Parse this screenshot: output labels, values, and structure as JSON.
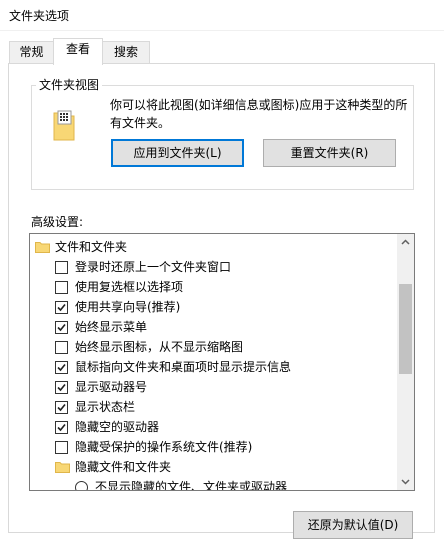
{
  "window": {
    "title": "文件夹选项"
  },
  "tabs": [
    {
      "label": "常规"
    },
    {
      "label": "查看"
    },
    {
      "label": "搜索"
    }
  ],
  "folder_views": {
    "legend": "文件夹视图",
    "description": "你可以将此视图(如详细信息或图标)应用于这种类型的所有文件夹。",
    "apply_button": "应用到文件夹(L)",
    "reset_button": "重置文件夹(R)"
  },
  "advanced": {
    "label": "高级设置:",
    "items": [
      {
        "type": "folder",
        "label": "文件和文件夹",
        "indent": 0
      },
      {
        "type": "checkbox",
        "label": "登录时还原上一个文件夹窗口",
        "checked": false,
        "indent": 1
      },
      {
        "type": "checkbox",
        "label": "使用复选框以选择项",
        "checked": false,
        "indent": 1
      },
      {
        "type": "checkbox",
        "label": "使用共享向导(推荐)",
        "checked": true,
        "indent": 1
      },
      {
        "type": "checkbox",
        "label": "始终显示菜单",
        "checked": true,
        "indent": 1
      },
      {
        "type": "checkbox",
        "label": "始终显示图标，从不显示缩略图",
        "checked": false,
        "indent": 1
      },
      {
        "type": "checkbox",
        "label": "鼠标指向文件夹和桌面项时显示提示信息",
        "checked": true,
        "indent": 1
      },
      {
        "type": "checkbox",
        "label": "显示驱动器号",
        "checked": true,
        "indent": 1
      },
      {
        "type": "checkbox",
        "label": "显示状态栏",
        "checked": true,
        "indent": 1
      },
      {
        "type": "checkbox",
        "label": "隐藏空的驱动器",
        "checked": true,
        "indent": 1
      },
      {
        "type": "checkbox",
        "label": "隐藏受保护的操作系统文件(推荐)",
        "checked": false,
        "indent": 1
      },
      {
        "type": "folder",
        "label": "隐藏文件和文件夹",
        "indent": 1
      },
      {
        "type": "radio",
        "label": "不显示隐藏的文件、文件夹或驱动器",
        "checked": false,
        "indent": 2
      }
    ]
  },
  "footer": {
    "restore_defaults": "还原为默认值(D)"
  },
  "colors": {
    "accent": "#0078d7",
    "folder": "#f8d775",
    "folder_dark": "#e0b64a"
  }
}
